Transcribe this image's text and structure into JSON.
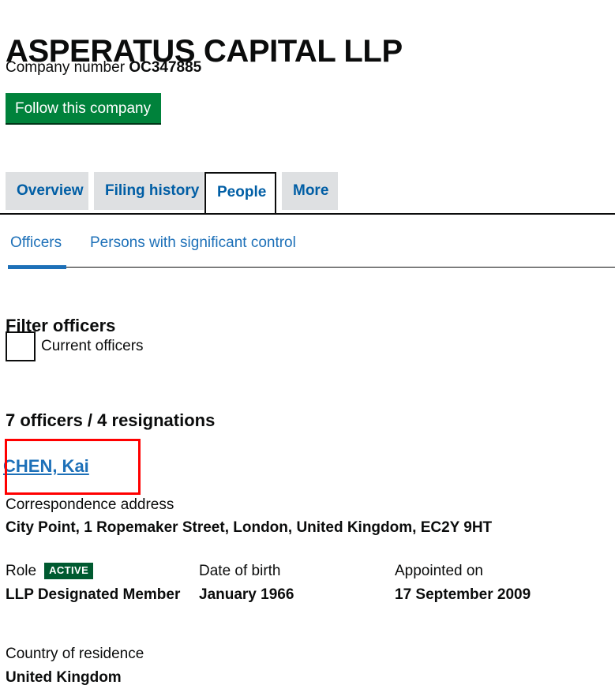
{
  "company": {
    "name": "ASPERATUS CAPITAL LLP",
    "number_label": "Company number",
    "number_value": "OC347885",
    "follow_button": "Follow this company"
  },
  "tabs": [
    {
      "label": "Overview",
      "active": false
    },
    {
      "label": "Filing history",
      "active": false
    },
    {
      "label": "People",
      "active": true
    },
    {
      "label": "More",
      "active": false
    }
  ],
  "subtabs": [
    {
      "label": "Officers",
      "active": true
    },
    {
      "label": "Persons with significant control",
      "active": false
    }
  ],
  "filter": {
    "heading": "Filter officers",
    "checkbox_label": "Current officers",
    "checked": false
  },
  "results": {
    "count_text": "7 officers / 4 resignations"
  },
  "officer": {
    "name": "CHEN, Kai",
    "correspondence_label": "Correspondence address",
    "correspondence_value": "City Point, 1 Ropemaker Street, London, United Kingdom, EC2Y 9HT",
    "role_label": "Role",
    "role_status": "ACTIVE",
    "role_value": "LLP Designated Member",
    "dob_label": "Date of birth",
    "dob_value": "January 1966",
    "appointed_label": "Appointed on",
    "appointed_value": "17 September 2009",
    "residence_label": "Country of residence",
    "residence_value": "United Kingdom"
  },
  "colors": {
    "brand_green": "#00823b",
    "status_green": "#005a30",
    "link_blue": "#1d70b8",
    "tab_blue": "#005ea5",
    "tab_grey": "#dee0e2",
    "highlight_red": "#ff0000",
    "text_black": "#0b0c0c"
  }
}
